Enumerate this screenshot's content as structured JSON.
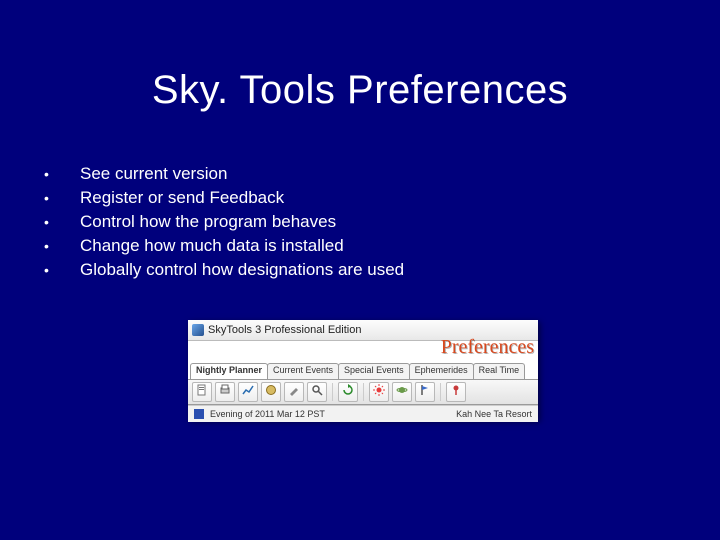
{
  "title": "Sky. Tools Preferences",
  "bullets": [
    "See current version",
    "Register or send Feedback",
    "Control how the program behaves",
    "Change how much data is installed",
    "Globally control how designations are used"
  ],
  "embedded": {
    "window_title": "SkyTools 3 Professional Edition",
    "overlay_label": "Preferences",
    "tabs": [
      "Nightly Planner",
      "Current Events",
      "Special Events",
      "Ephemerides",
      "Real Time"
    ],
    "active_tab_index": 0,
    "status_left": "Evening of 2011 Mar 12 PST",
    "status_right": "Kah Nee Ta Resort"
  }
}
